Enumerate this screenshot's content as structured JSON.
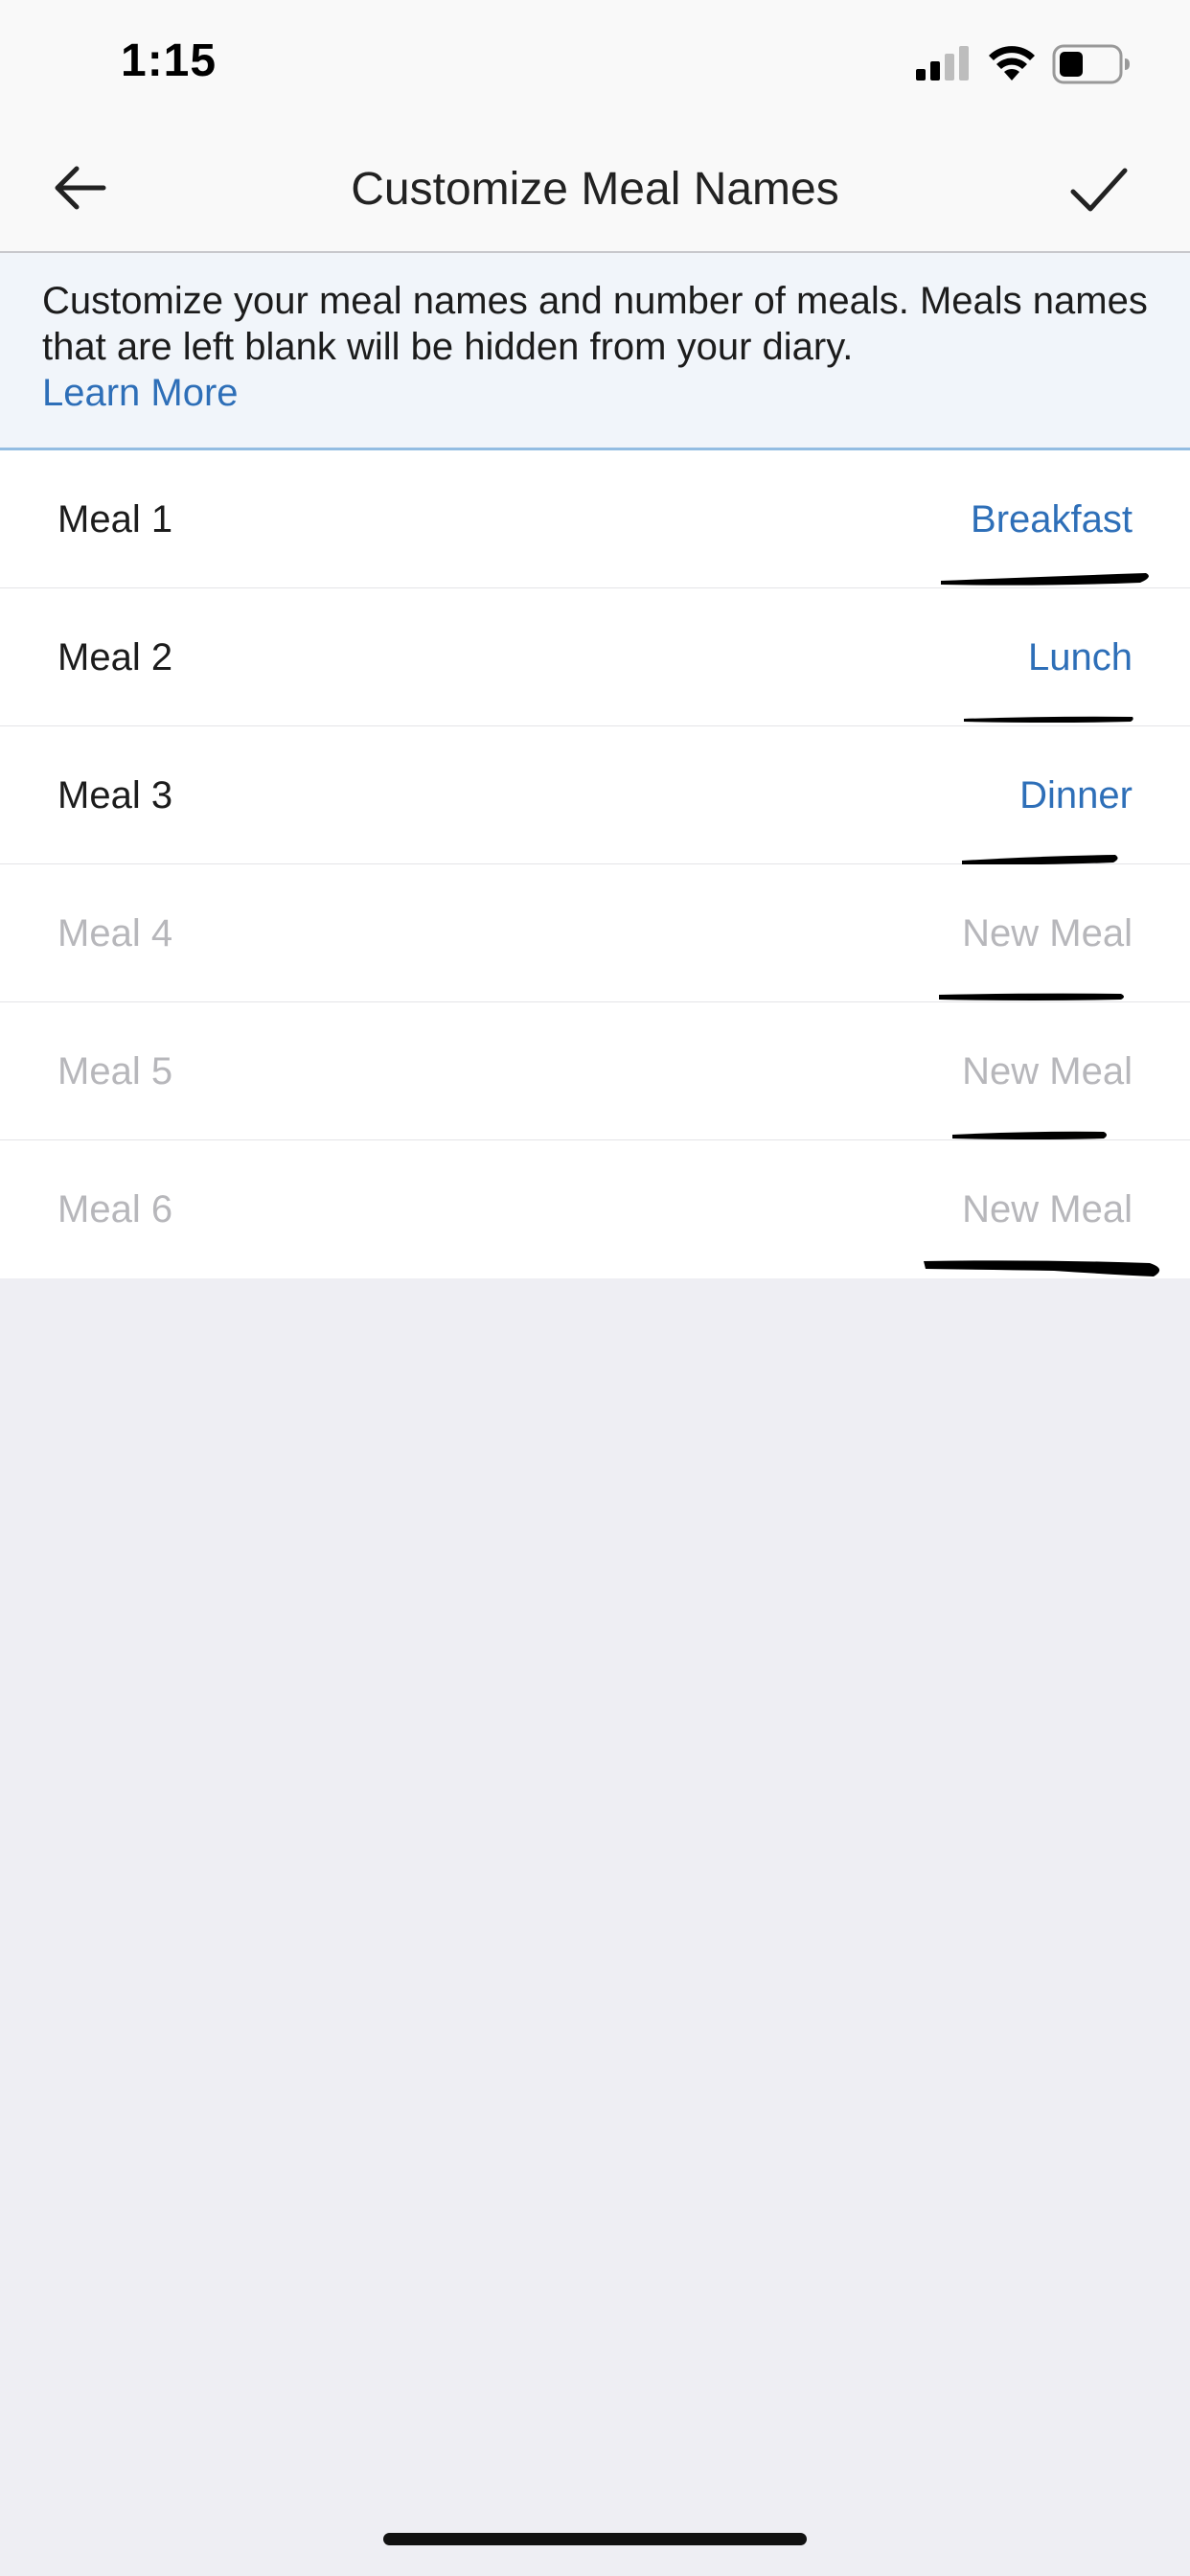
{
  "status_bar": {
    "time": "1:15"
  },
  "header": {
    "title": "Customize Meal Names",
    "back_icon": "arrow-left-icon",
    "save_icon": "checkmark-icon"
  },
  "banner": {
    "text": "Customize your meal names and number of meals. Meals names that are left blank will be hidden from your diary.",
    "link_text": "Learn More"
  },
  "meals": [
    {
      "label": "Meal 1",
      "value": "Breakfast",
      "placeholder": ""
    },
    {
      "label": "Meal 2",
      "value": "Lunch",
      "placeholder": ""
    },
    {
      "label": "Meal 3",
      "value": "Dinner",
      "placeholder": ""
    },
    {
      "label": "Meal 4",
      "value": "",
      "placeholder": "New Meal"
    },
    {
      "label": "Meal 5",
      "value": "",
      "placeholder": "New Meal"
    },
    {
      "label": "Meal 6",
      "value": "",
      "placeholder": "New Meal"
    }
  ],
  "colors": {
    "accent": "#2e6fb8",
    "placeholder": "#b7b7bb",
    "banner_bg": "#f1f5fa",
    "page_bg": "#eeeef3"
  }
}
